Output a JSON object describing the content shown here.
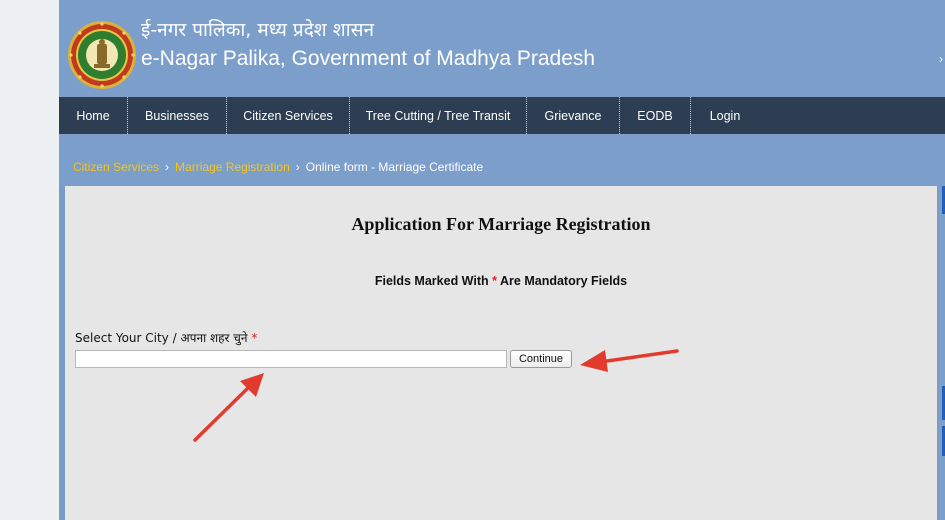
{
  "header": {
    "title_hindi": "ई-नगर पालिका, मध्य प्रदेश शासन",
    "title_english": "e-Nagar Palika, Government of Madhya Pradesh",
    "logo_icon": "mp-government-emblem-icon"
  },
  "nav": {
    "items": [
      {
        "label": "Home"
      },
      {
        "label": "Businesses"
      },
      {
        "label": "Citizen Services"
      },
      {
        "label": "Tree Cutting / Tree Transit"
      },
      {
        "label": "Grievance"
      },
      {
        "label": "EODB"
      },
      {
        "label": "Login"
      }
    ]
  },
  "breadcrumb": {
    "items": [
      {
        "label": "Citizen Services"
      },
      {
        "label": "Marriage Registration"
      },
      {
        "label": "Online form - Marriage Certificate"
      }
    ],
    "separator": "›"
  },
  "form": {
    "title": "Application For Marriage Registration",
    "note_prefix": "Fields Marked With",
    "note_star": "*",
    "note_suffix": "Are Mandatory Fields",
    "city_label": "Select Your City / अपना शहर चुने",
    "city_required_star": "*",
    "city_input_value": "",
    "continue_label": "Continue"
  },
  "colors": {
    "header_bg": "#7c9ecb",
    "nav_bg": "#2e3e52",
    "breadcrumb_link": "#f5c518",
    "content_bg": "#e6e6e6",
    "required": "#e02020",
    "annotation_arrow": "#e23b2e"
  }
}
